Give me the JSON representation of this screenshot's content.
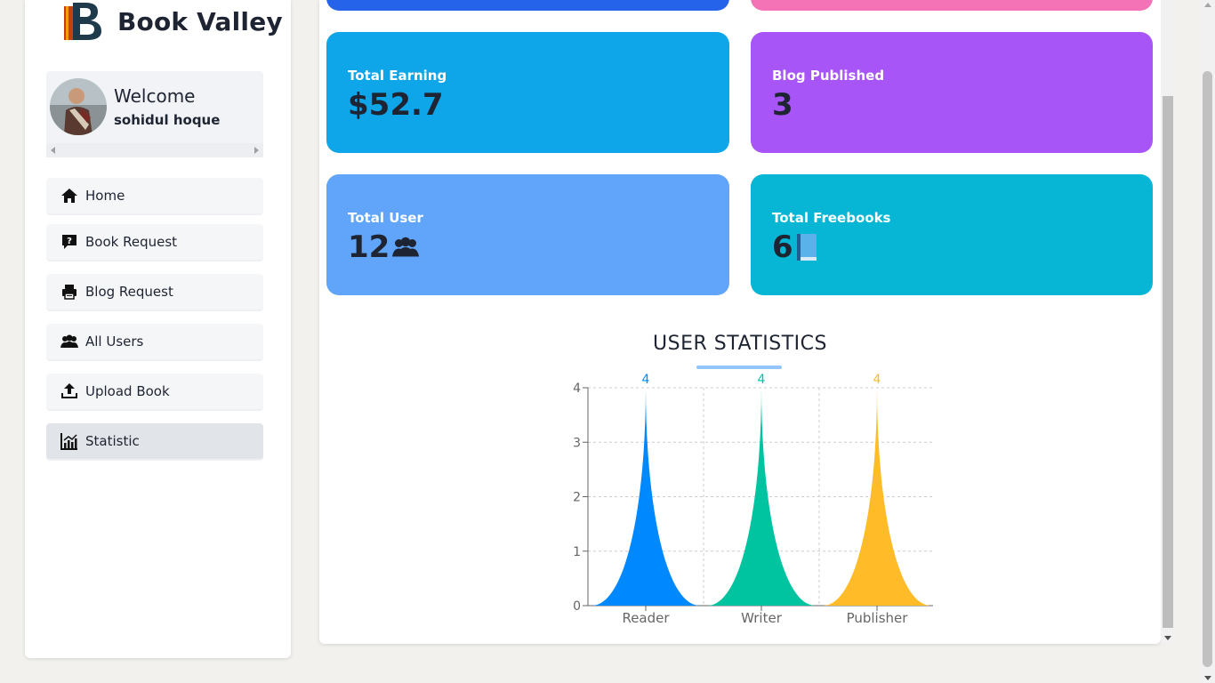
{
  "brand": {
    "name": "Book Valley",
    "logo_icon": "book-valley-logo-icon"
  },
  "welcome": {
    "title": "Welcome",
    "user_name": "sohidul hoque"
  },
  "nav": {
    "items": [
      {
        "label": "Home",
        "icon": "home-icon",
        "active": false
      },
      {
        "label": "Book Request",
        "icon": "question-box-icon",
        "active": false
      },
      {
        "label": "Blog Request",
        "icon": "printer-icon",
        "active": false
      },
      {
        "label": "All Users",
        "icon": "users-icon",
        "active": false
      },
      {
        "label": "Upload Book",
        "icon": "upload-icon",
        "active": false
      },
      {
        "label": "Statistic",
        "icon": "chart-icon",
        "active": true
      }
    ]
  },
  "cards": [
    {
      "label": "Total Earning",
      "value": "$52.7",
      "color": "#0ea5e9"
    },
    {
      "label": "Blog Published",
      "value": "3",
      "color": "#a855f7"
    },
    {
      "label": "Total User",
      "value": "12",
      "icon": "users-icon",
      "color": "#60a5fa"
    },
    {
      "label": "Total Freebooks",
      "value": "6",
      "icon": "book-icon",
      "color": "#06b6d4"
    }
  ],
  "top_cards": [
    {
      "color": "#2563eb"
    },
    {
      "color": "#f472b6"
    }
  ],
  "chart_title": "USER STATISTICS",
  "chart_data": {
    "type": "bar",
    "categories": [
      "Reader",
      "Writer",
      "Publisher"
    ],
    "values": [
      4,
      4,
      4
    ],
    "colors": [
      "#0088FE",
      "#00C49F",
      "#FFBB28"
    ],
    "ylim": [
      0,
      4
    ],
    "yticks": [
      0,
      1,
      2,
      3,
      4
    ],
    "grid": true,
    "bar_shape": "triangle"
  }
}
